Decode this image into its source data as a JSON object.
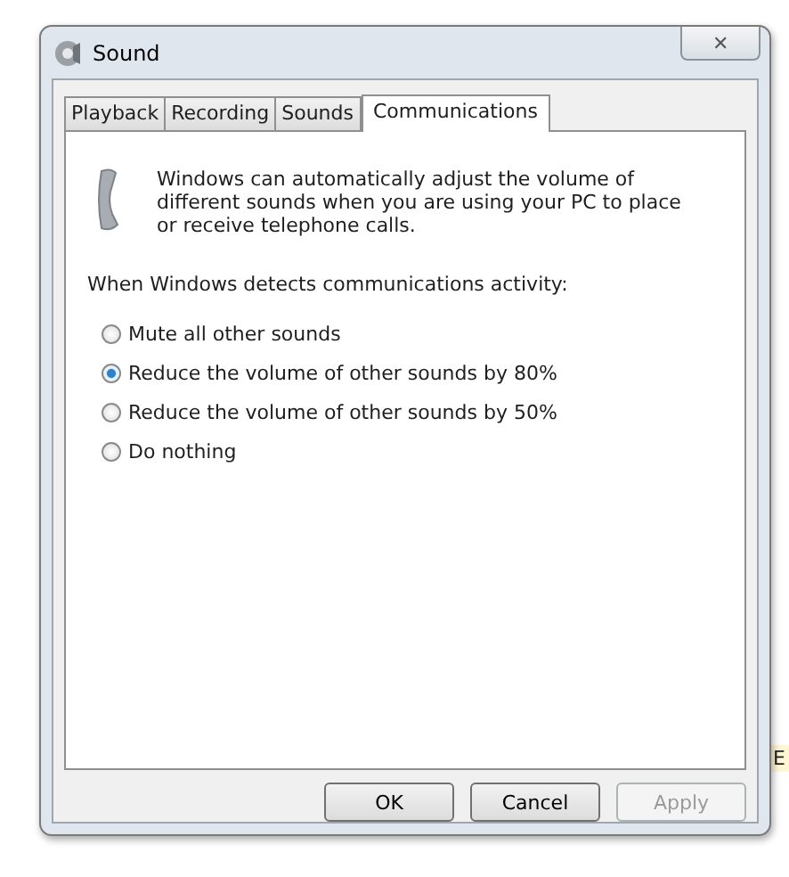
{
  "window": {
    "title": "Sound",
    "close": "✕"
  },
  "tabs": [
    {
      "label": "Playback",
      "selected": false
    },
    {
      "label": "Recording",
      "selected": false
    },
    {
      "label": "Sounds",
      "selected": false
    },
    {
      "label": "Communications",
      "selected": true
    }
  ],
  "description": "Windows can automatically adjust the volume of different sounds when you are using your PC to place or receive telephone calls.",
  "prompt": "When Windows detects communications activity:",
  "options": [
    {
      "label": "Mute all other sounds",
      "selected": false
    },
    {
      "label": "Reduce the volume of other sounds by 80%",
      "selected": true
    },
    {
      "label": "Reduce the volume of other sounds by 50%",
      "selected": false
    },
    {
      "label": "Do nothing",
      "selected": false
    }
  ],
  "buttons": [
    {
      "label": "OK",
      "disabled": false
    },
    {
      "label": "Cancel",
      "disabled": false
    },
    {
      "label": "Apply",
      "disabled": true
    }
  ],
  "background_fragment": "E"
}
